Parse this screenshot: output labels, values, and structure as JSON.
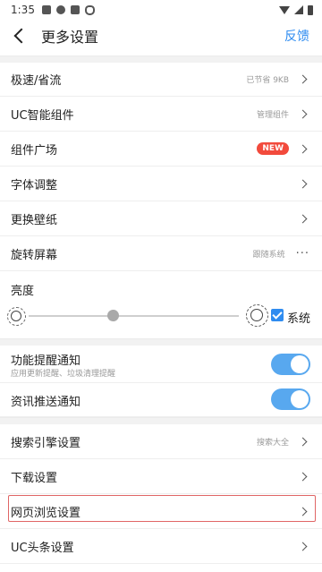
{
  "status_bar": {
    "time": "1:35"
  },
  "header": {
    "title": "更多设置",
    "feedback": "反馈"
  },
  "rows": [
    {
      "label": "极速/省流",
      "value": "已节省 9KB"
    },
    {
      "label": "UC智能组件",
      "value": "管理组件"
    },
    {
      "label": "组件广场",
      "badge": "NEW"
    },
    {
      "label": "字体调整"
    },
    {
      "label": "更换壁纸"
    },
    {
      "label": "旋转屏幕",
      "value": "跟随系统",
      "more": "···"
    }
  ],
  "brightness": {
    "label": "亮度",
    "level_fraction": 0.4,
    "system_label": "系统",
    "system_checked": true
  },
  "notifications": [
    {
      "label": "功能提醒通知",
      "desc": "应用更新提醒、垃圾清理提醒",
      "on": true
    },
    {
      "label": "资讯推送通知",
      "on": true
    }
  ],
  "rows2": [
    {
      "label": "搜索引擎设置",
      "value": "搜索大全"
    },
    {
      "label": "下载设置"
    },
    {
      "label": "网页浏览设置",
      "highlighted": true
    },
    {
      "label": "UC头条设置"
    }
  ],
  "colors": {
    "accent": "#2f8cf0",
    "badge": "#f24a3c",
    "toggle": "#58a8ef",
    "highlight": "#e06666"
  }
}
